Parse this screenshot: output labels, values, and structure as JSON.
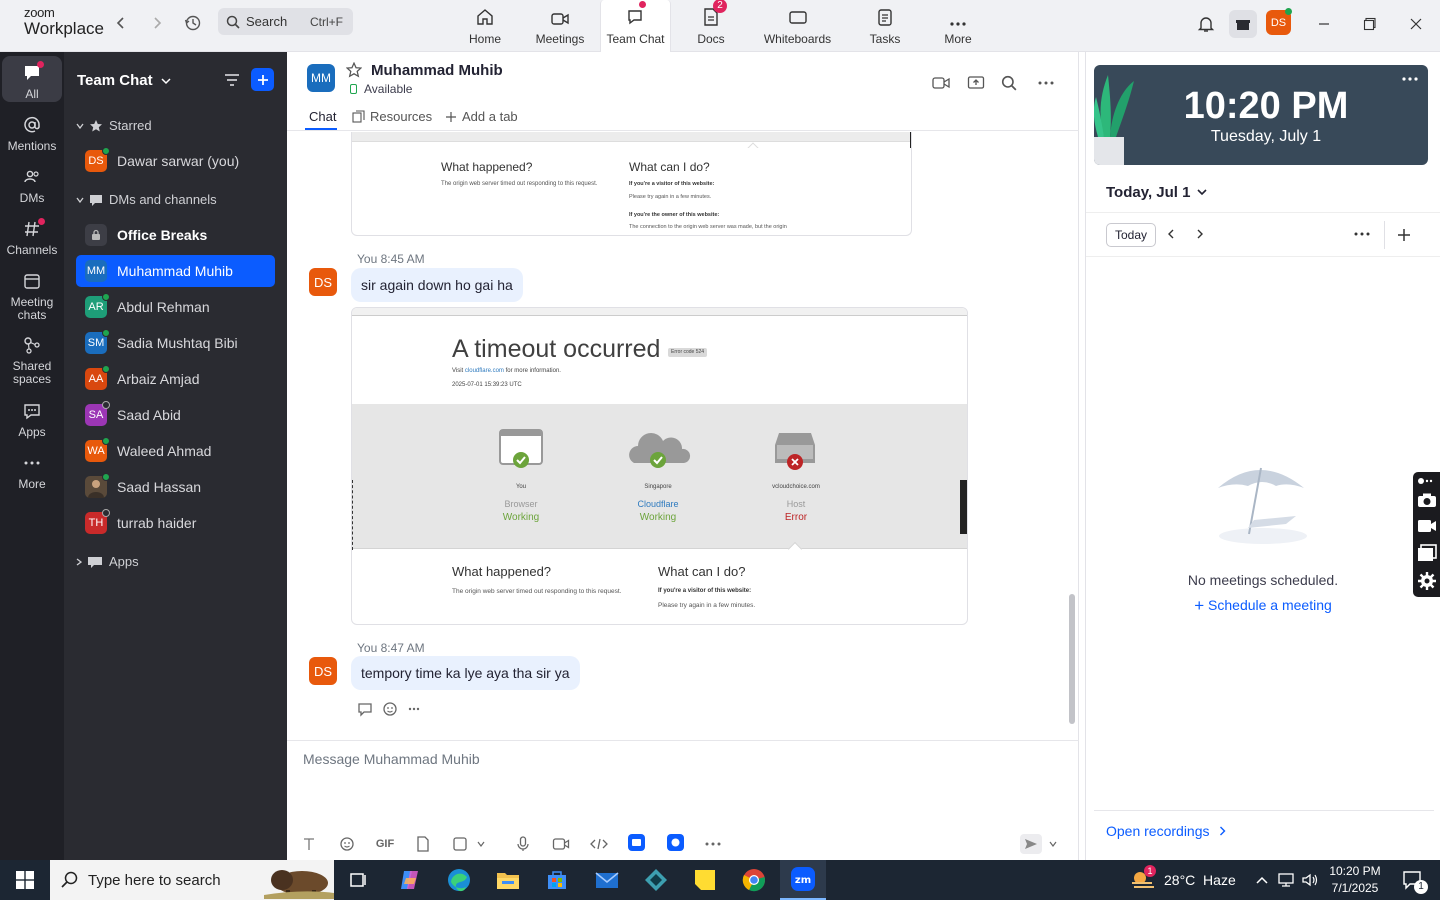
{
  "app": {
    "logo_line1": "zoom",
    "logo_line2": "Workplace"
  },
  "search": {
    "placeholder": "Search",
    "shortcut": "Ctrl+F"
  },
  "top_tabs": [
    {
      "label": "Home"
    },
    {
      "label": "Meetings"
    },
    {
      "label": "Team Chat"
    },
    {
      "label": "Docs",
      "badge": "2"
    },
    {
      "label": "Whiteboards"
    },
    {
      "label": "Tasks"
    },
    {
      "label": "More"
    }
  ],
  "user_avatar": "DS",
  "rail": [
    {
      "label": "All"
    },
    {
      "label": "Mentions"
    },
    {
      "label": "DMs"
    },
    {
      "label": "Channels"
    },
    {
      "label": "Meeting chats"
    },
    {
      "label": "Shared spaces"
    },
    {
      "label": "Apps"
    },
    {
      "label": "More"
    }
  ],
  "left_panel": {
    "title": "Team Chat",
    "sections": {
      "starred": "Starred",
      "dms": "DMs and channels",
      "apps": "Apps"
    },
    "starred": [
      {
        "initials": "DS",
        "name": "Dawar sarwar (you)",
        "color": "#e8590c"
      }
    ],
    "channels": [
      {
        "name": "Office Breaks"
      }
    ],
    "dms": [
      {
        "initials": "MM",
        "name": "Muhammad Muhib",
        "color": "#1a6dbd"
      },
      {
        "initials": "AR",
        "name": "Abdul Rehman",
        "color": "#1e9e78"
      },
      {
        "initials": "SM",
        "name": "Sadia Mushtaq Bibi",
        "color": "#1a6dbd"
      },
      {
        "initials": "AA",
        "name": "Arbaiz Amjad",
        "color": "#d9480f"
      },
      {
        "initials": "SA",
        "name": "Saad Abid",
        "color": "#9c36b5"
      },
      {
        "initials": "WA",
        "name": "Waleed Ahmad",
        "color": "#e8590c"
      },
      {
        "initials": "",
        "name": "Saad Hassan",
        "color": "#5a4a3a"
      },
      {
        "initials": "TH",
        "name": "turrab haider",
        "color": "#c92a2a"
      }
    ]
  },
  "chat": {
    "contact_initials": "MM",
    "contact_name": "Muhammad Muhib",
    "status": "Available",
    "tabs": [
      "Chat",
      "Resources",
      "Add a tab"
    ],
    "messages": [
      {
        "meta": "You 8:45 AM",
        "text": "sir again down ho gai ha",
        "initials": "DS"
      },
      {
        "meta": "You 8:47 AM",
        "text": "tempory time ka lye aya tha sir ya",
        "initials": "DS"
      }
    ],
    "composer_placeholder": "Message Muhammad Muhib",
    "gif_label": "GIF"
  },
  "shot1": {
    "what_happened": "What happened?",
    "what_happened_body": "The origin web server timed out responding to this request.",
    "what_can": "What can I do?",
    "visitor": "If you're a visitor of this website:",
    "visitor_body": "Please try again in a few minutes.",
    "owner": "If you're the owner of this website:",
    "owner_body": "The connection to the origin web server was made, but the origin"
  },
  "shot2": {
    "title": "A timeout occurred",
    "code": "Error code 524",
    "visit_pre": "Visit",
    "visit_link": "cloudflare.com",
    "visit_post": "for more information.",
    "timestamp": "2025-07-01 15:39:23 UTC",
    "nodes": [
      {
        "top": "You",
        "name": "Browser",
        "status": "Working"
      },
      {
        "top": "Singapore",
        "name": "Cloudflare",
        "status": "Working"
      },
      {
        "top": "vcloudchoice.com",
        "name": "Host",
        "status": "Error"
      }
    ],
    "what_happened": "What happened?",
    "what_happened_body": "The origin web server timed out responding to this request.",
    "what_can": "What can I do?",
    "visitor": "If you're a visitor of this website:",
    "visitor_body": "Please try again in a few minutes."
  },
  "calendar": {
    "time": "10:20 PM",
    "date": "Tuesday, July 1",
    "selector": "Today, Jul 1",
    "today_btn": "Today",
    "no_meetings": "No meetings scheduled.",
    "schedule": "Schedule a meeting",
    "open_recordings": "Open recordings"
  },
  "taskbar": {
    "search_placeholder": "Type here to search",
    "weather": "28°C  Haze",
    "weather_badge": "1",
    "time": "10:20 PM",
    "date": "7/1/2025",
    "notif_count": "1"
  },
  "colors": {
    "accent": "#0b5cff",
    "rail": "#1f2026",
    "panel": "#2a2b31",
    "bubble": "#e9f1fe",
    "error": "#bd2426",
    "working": "#6ca43b"
  }
}
